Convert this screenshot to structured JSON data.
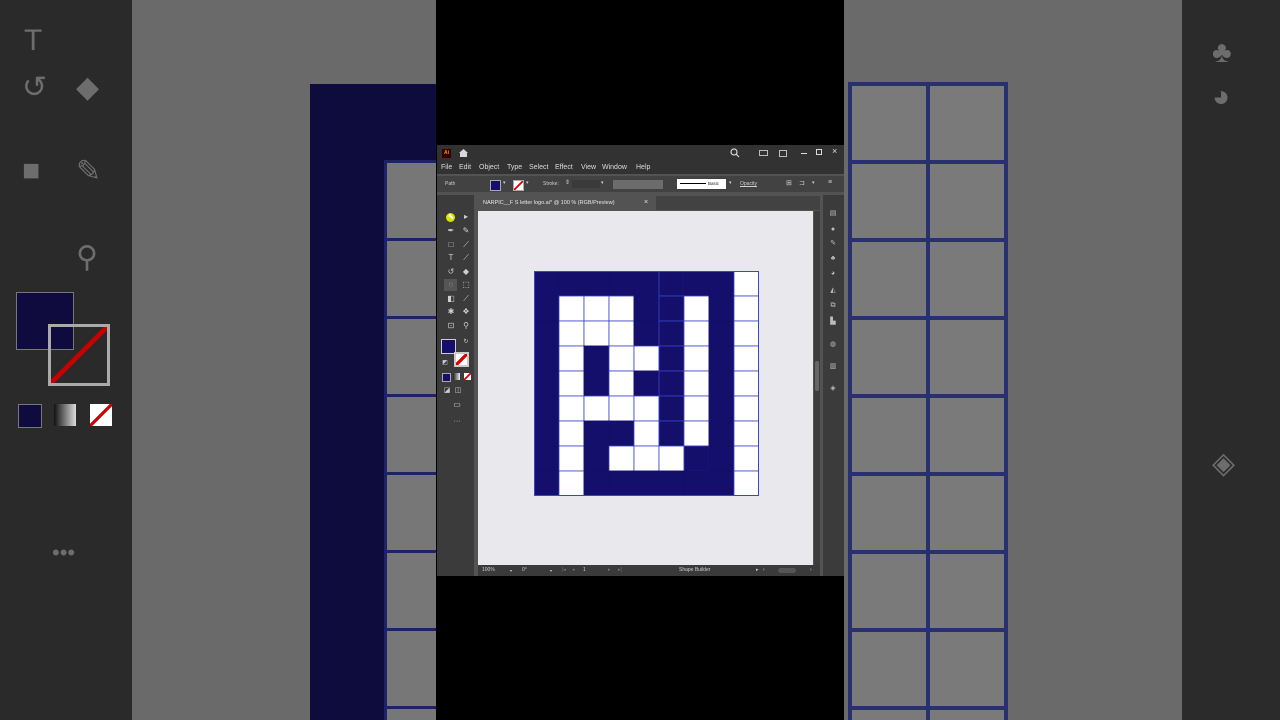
{
  "app": {
    "logo": "Ai",
    "menu": [
      "File",
      "Edit",
      "Object",
      "Type",
      "Select",
      "Effect",
      "View",
      "Window",
      "Help"
    ]
  },
  "control_bar": {
    "selection_label": "Path",
    "stroke_label": "Stroke:",
    "brush_label": "Basic",
    "opacity_label": "Opacity"
  },
  "document": {
    "tab_title": "NARPIC__F S letter logo.ai* @ 100 % (RGB/Preview)",
    "close_glyph": "×"
  },
  "status": {
    "zoom": "100%",
    "rotation": "0°",
    "artboard": "1",
    "tool_name": "Shape Builder"
  },
  "colors": {
    "fill": "#130f6a",
    "cell_stroke": "#3b44c8",
    "artboard_bg": "#e9e8ed",
    "ui_dark": "#323232",
    "ui_mid": "#535353"
  },
  "artwork": {
    "rows": 9,
    "cols": 9,
    "pattern": [
      "11111011.",
      "1...10.1.",
      "1...10.1.",
      "1.1..0.1.",
      "1.1.10.1.",
      "1....0.1.",
      "1.11.0.1.",
      "1.1...01.",
      "1.111111."
    ]
  },
  "icons": {
    "search": "search-icon",
    "home": "home-icon",
    "shape_builder": "shape-builder-icon"
  }
}
